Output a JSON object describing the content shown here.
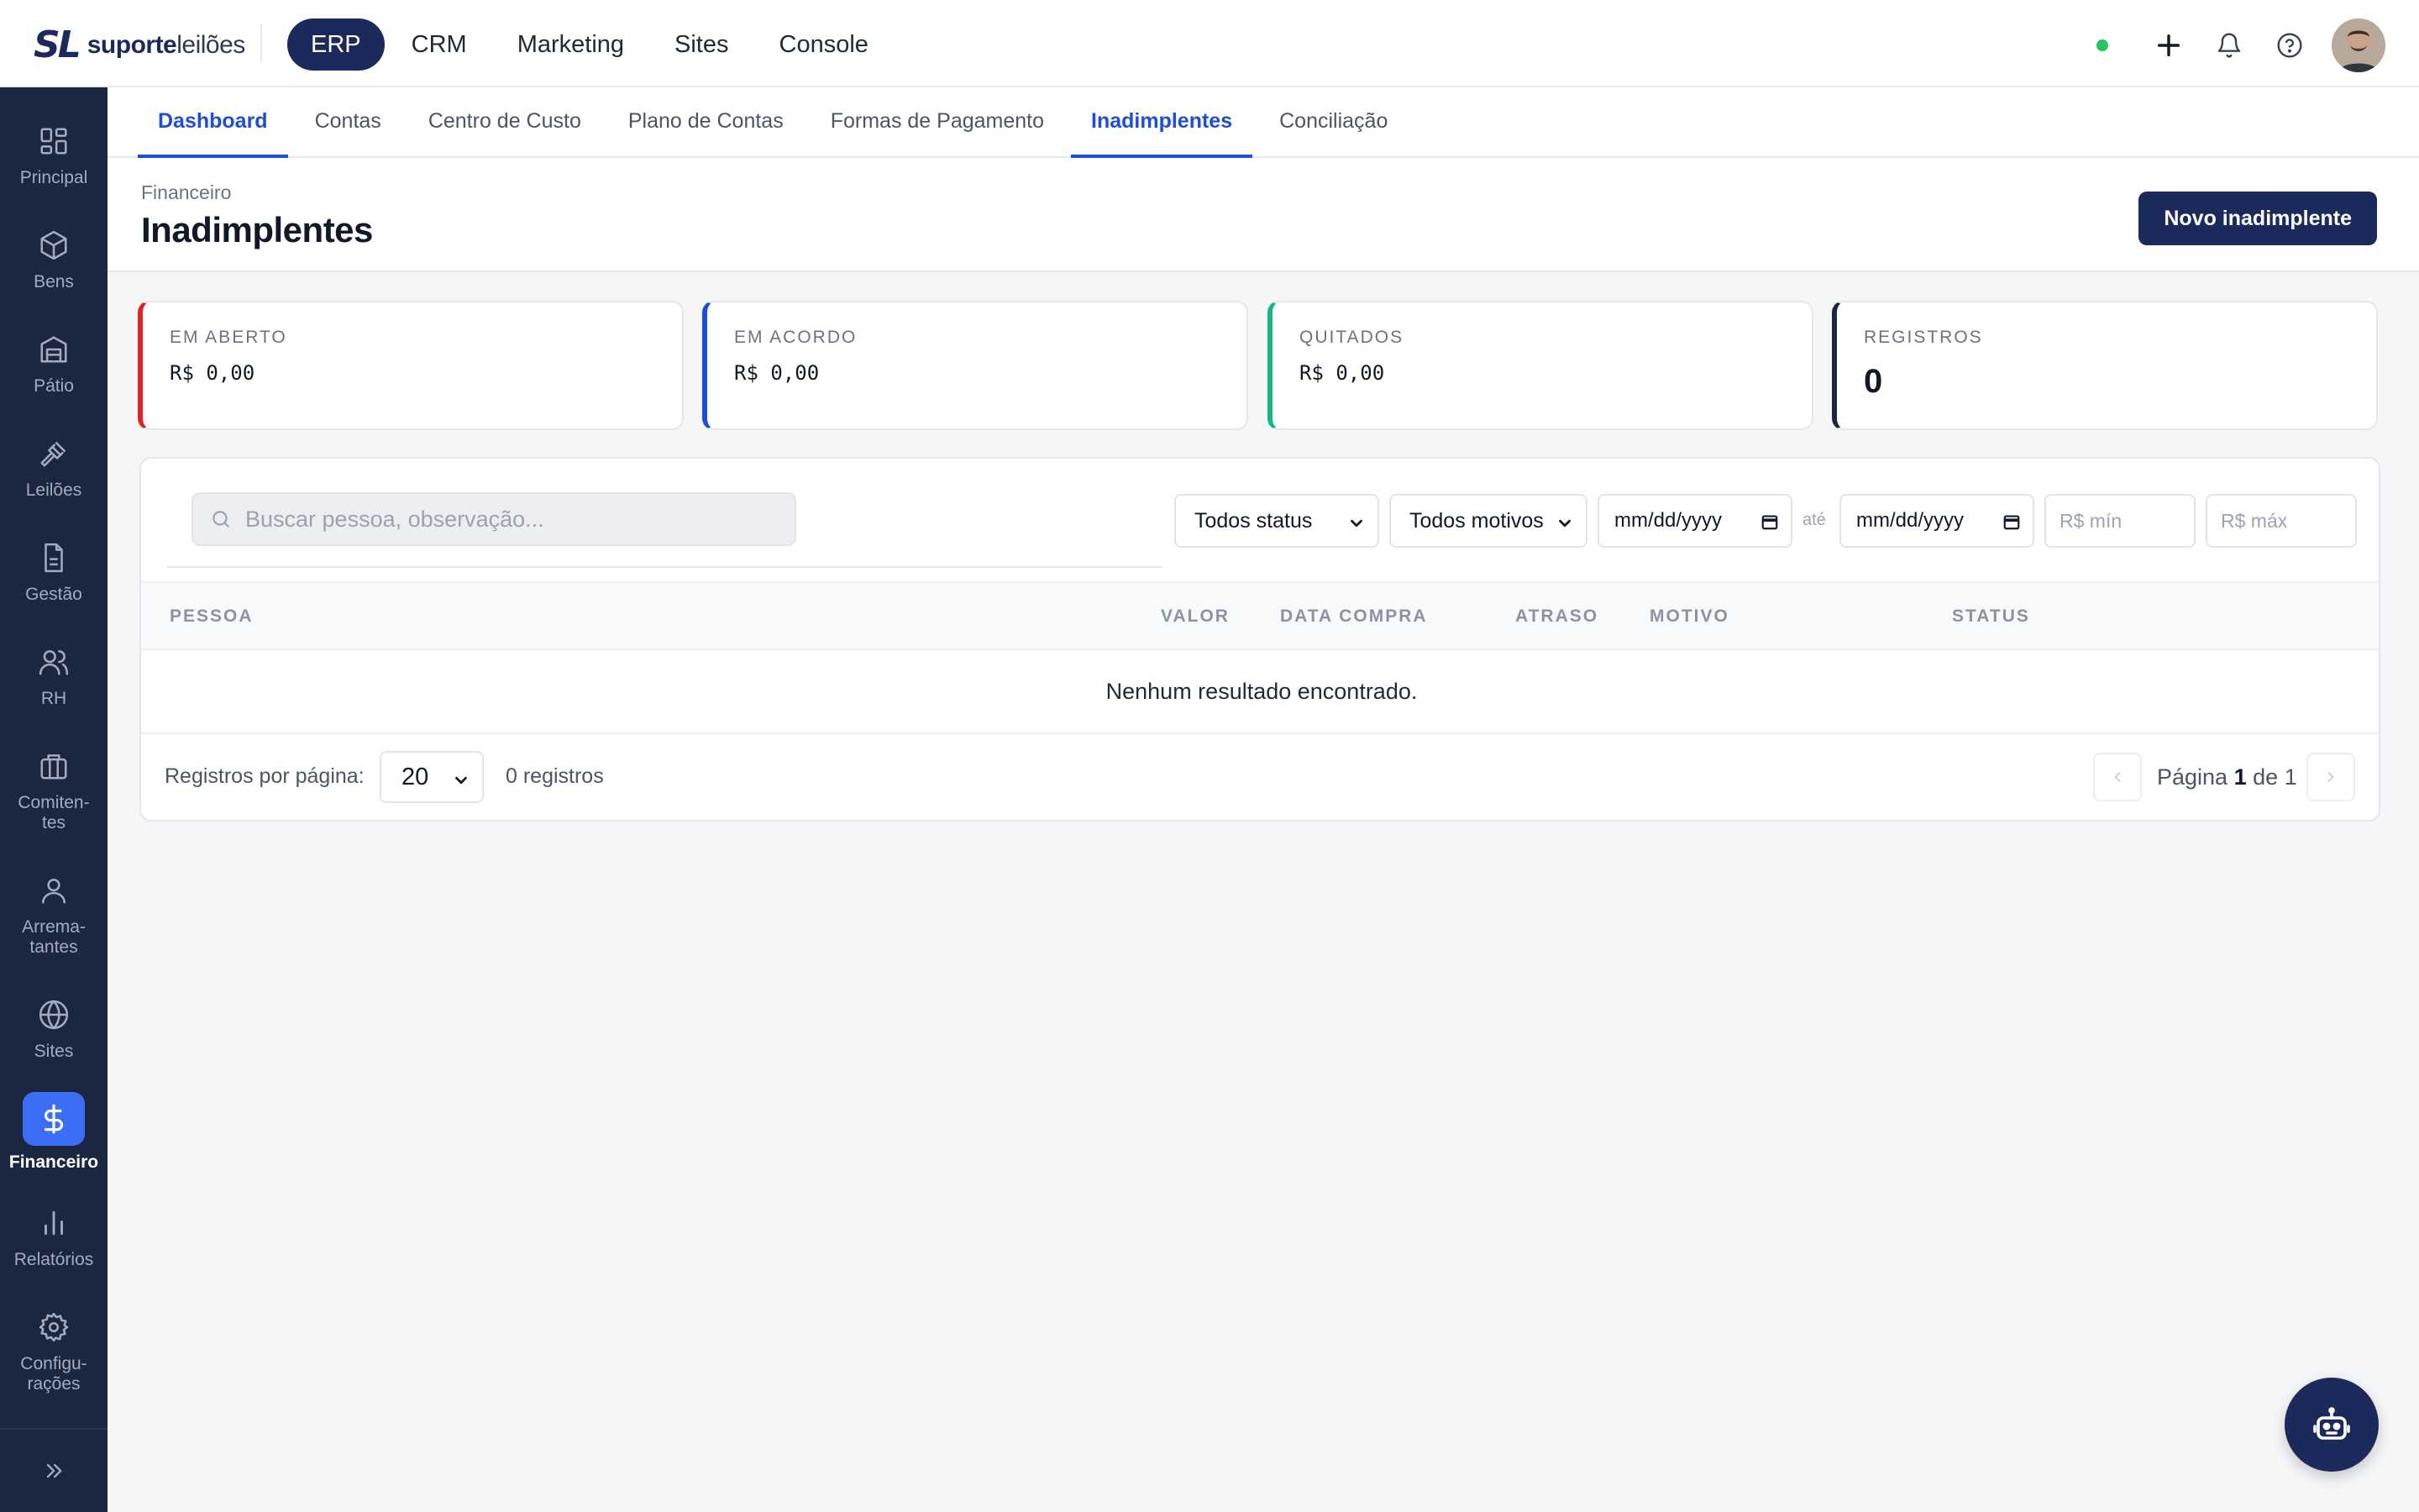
{
  "brand": {
    "mark": "SL",
    "name_bold": "suporte",
    "name_light": "leilões"
  },
  "topnav": [
    {
      "label": "ERP",
      "active": true
    },
    {
      "label": "CRM"
    },
    {
      "label": "Marketing"
    },
    {
      "label": "Sites"
    },
    {
      "label": "Console"
    }
  ],
  "topbar_icons": [
    "status-online-icon",
    "plus-icon",
    "bell-icon",
    "help-icon",
    "avatar"
  ],
  "sidebar": {
    "items": [
      {
        "label": "Principal",
        "icon": "grid-icon"
      },
      {
        "label": "Bens",
        "icon": "box-icon"
      },
      {
        "label": "Pátio",
        "icon": "warehouse-icon"
      },
      {
        "label": "Leilões",
        "icon": "gavel-icon"
      },
      {
        "label": "Gestão",
        "icon": "document-icon"
      },
      {
        "label": "RH",
        "icon": "users-icon"
      },
      {
        "label": "Comiten-\ntes",
        "icon": "briefcase-icon"
      },
      {
        "label": "Arrema-\ntantes",
        "icon": "user-icon"
      },
      {
        "label": "Sites",
        "icon": "globe-icon"
      },
      {
        "label": "Financeiro",
        "icon": "dollar-icon",
        "active": true
      },
      {
        "label": "Relatórios",
        "icon": "bar-chart-icon"
      },
      {
        "label": "Configu-\nrações",
        "icon": "gear-icon"
      }
    ],
    "collapse_icon": "chevrons-right-icon"
  },
  "subnav": [
    {
      "label": "Dashboard",
      "active": true
    },
    {
      "label": "Contas"
    },
    {
      "label": "Centro de Custo"
    },
    {
      "label": "Plano de Contas"
    },
    {
      "label": "Formas de Pagamento"
    },
    {
      "label": "Inadimplentes",
      "active": true
    },
    {
      "label": "Conciliação"
    }
  ],
  "page": {
    "breadcrumb": "Financeiro",
    "title": "Inadimplentes",
    "new_button": "Novo inadimplente"
  },
  "stats": [
    {
      "label": "EM ABERTO",
      "value": "R$ 0,00",
      "color": "#dc2626"
    },
    {
      "label": "EM ACORDO",
      "value": "R$ 0,00",
      "color": "#1d4ed8"
    },
    {
      "label": "QUITADOS",
      "value": "R$ 0,00",
      "color": "#10b981"
    },
    {
      "label": "REGISTROS",
      "value": "0",
      "color": "#1b2640"
    }
  ],
  "filters": {
    "search_placeholder": "Buscar pessoa, observação...",
    "status": "Todos status",
    "motivo": "Todos motivos",
    "date_from": "mm/dd/yyyy",
    "ate": "até",
    "date_to": "mm/dd/yyyy",
    "min_placeholder": "R$ mín",
    "max_placeholder": "R$ máx"
  },
  "table": {
    "columns": [
      "PESSOA",
      "VALOR",
      "DATA COMPRA",
      "ATRASO",
      "MOTIVO",
      "STATUS"
    ],
    "empty_text": "Nenhum resultado encontrado."
  },
  "pagination": {
    "per_page_label": "Registros por página:",
    "per_page": "20",
    "count": "0 registros",
    "page_prefix": "Página",
    "page": "1",
    "page_of": "de",
    "total_pages": "1"
  },
  "assistant_icon": "robot-icon"
}
